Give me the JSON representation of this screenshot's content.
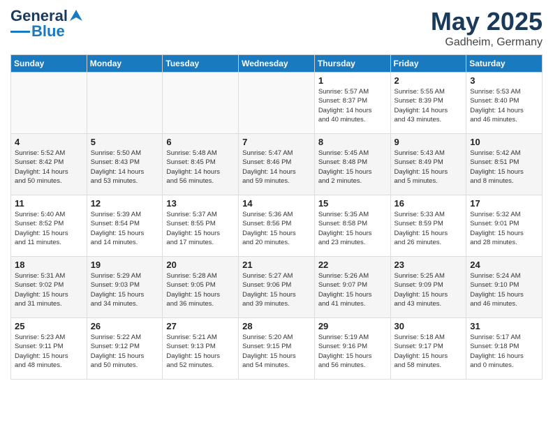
{
  "logo": {
    "text1": "General",
    "text2": "Blue"
  },
  "title": "May 2025",
  "location": "Gadheim, Germany",
  "weekdays": [
    "Sunday",
    "Monday",
    "Tuesday",
    "Wednesday",
    "Thursday",
    "Friday",
    "Saturday"
  ],
  "weeks": [
    [
      {
        "day": "",
        "info": ""
      },
      {
        "day": "",
        "info": ""
      },
      {
        "day": "",
        "info": ""
      },
      {
        "day": "",
        "info": ""
      },
      {
        "day": "1",
        "info": "Sunrise: 5:57 AM\nSunset: 8:37 PM\nDaylight: 14 hours\nand 40 minutes."
      },
      {
        "day": "2",
        "info": "Sunrise: 5:55 AM\nSunset: 8:39 PM\nDaylight: 14 hours\nand 43 minutes."
      },
      {
        "day": "3",
        "info": "Sunrise: 5:53 AM\nSunset: 8:40 PM\nDaylight: 14 hours\nand 46 minutes."
      }
    ],
    [
      {
        "day": "4",
        "info": "Sunrise: 5:52 AM\nSunset: 8:42 PM\nDaylight: 14 hours\nand 50 minutes."
      },
      {
        "day": "5",
        "info": "Sunrise: 5:50 AM\nSunset: 8:43 PM\nDaylight: 14 hours\nand 53 minutes."
      },
      {
        "day": "6",
        "info": "Sunrise: 5:48 AM\nSunset: 8:45 PM\nDaylight: 14 hours\nand 56 minutes."
      },
      {
        "day": "7",
        "info": "Sunrise: 5:47 AM\nSunset: 8:46 PM\nDaylight: 14 hours\nand 59 minutes."
      },
      {
        "day": "8",
        "info": "Sunrise: 5:45 AM\nSunset: 8:48 PM\nDaylight: 15 hours\nand 2 minutes."
      },
      {
        "day": "9",
        "info": "Sunrise: 5:43 AM\nSunset: 8:49 PM\nDaylight: 15 hours\nand 5 minutes."
      },
      {
        "day": "10",
        "info": "Sunrise: 5:42 AM\nSunset: 8:51 PM\nDaylight: 15 hours\nand 8 minutes."
      }
    ],
    [
      {
        "day": "11",
        "info": "Sunrise: 5:40 AM\nSunset: 8:52 PM\nDaylight: 15 hours\nand 11 minutes."
      },
      {
        "day": "12",
        "info": "Sunrise: 5:39 AM\nSunset: 8:54 PM\nDaylight: 15 hours\nand 14 minutes."
      },
      {
        "day": "13",
        "info": "Sunrise: 5:37 AM\nSunset: 8:55 PM\nDaylight: 15 hours\nand 17 minutes."
      },
      {
        "day": "14",
        "info": "Sunrise: 5:36 AM\nSunset: 8:56 PM\nDaylight: 15 hours\nand 20 minutes."
      },
      {
        "day": "15",
        "info": "Sunrise: 5:35 AM\nSunset: 8:58 PM\nDaylight: 15 hours\nand 23 minutes."
      },
      {
        "day": "16",
        "info": "Sunrise: 5:33 AM\nSunset: 8:59 PM\nDaylight: 15 hours\nand 26 minutes."
      },
      {
        "day": "17",
        "info": "Sunrise: 5:32 AM\nSunset: 9:01 PM\nDaylight: 15 hours\nand 28 minutes."
      }
    ],
    [
      {
        "day": "18",
        "info": "Sunrise: 5:31 AM\nSunset: 9:02 PM\nDaylight: 15 hours\nand 31 minutes."
      },
      {
        "day": "19",
        "info": "Sunrise: 5:29 AM\nSunset: 9:03 PM\nDaylight: 15 hours\nand 34 minutes."
      },
      {
        "day": "20",
        "info": "Sunrise: 5:28 AM\nSunset: 9:05 PM\nDaylight: 15 hours\nand 36 minutes."
      },
      {
        "day": "21",
        "info": "Sunrise: 5:27 AM\nSunset: 9:06 PM\nDaylight: 15 hours\nand 39 minutes."
      },
      {
        "day": "22",
        "info": "Sunrise: 5:26 AM\nSunset: 9:07 PM\nDaylight: 15 hours\nand 41 minutes."
      },
      {
        "day": "23",
        "info": "Sunrise: 5:25 AM\nSunset: 9:09 PM\nDaylight: 15 hours\nand 43 minutes."
      },
      {
        "day": "24",
        "info": "Sunrise: 5:24 AM\nSunset: 9:10 PM\nDaylight: 15 hours\nand 46 minutes."
      }
    ],
    [
      {
        "day": "25",
        "info": "Sunrise: 5:23 AM\nSunset: 9:11 PM\nDaylight: 15 hours\nand 48 minutes."
      },
      {
        "day": "26",
        "info": "Sunrise: 5:22 AM\nSunset: 9:12 PM\nDaylight: 15 hours\nand 50 minutes."
      },
      {
        "day": "27",
        "info": "Sunrise: 5:21 AM\nSunset: 9:13 PM\nDaylight: 15 hours\nand 52 minutes."
      },
      {
        "day": "28",
        "info": "Sunrise: 5:20 AM\nSunset: 9:15 PM\nDaylight: 15 hours\nand 54 minutes."
      },
      {
        "day": "29",
        "info": "Sunrise: 5:19 AM\nSunset: 9:16 PM\nDaylight: 15 hours\nand 56 minutes."
      },
      {
        "day": "30",
        "info": "Sunrise: 5:18 AM\nSunset: 9:17 PM\nDaylight: 15 hours\nand 58 minutes."
      },
      {
        "day": "31",
        "info": "Sunrise: 5:17 AM\nSunset: 9:18 PM\nDaylight: 16 hours\nand 0 minutes."
      }
    ]
  ]
}
